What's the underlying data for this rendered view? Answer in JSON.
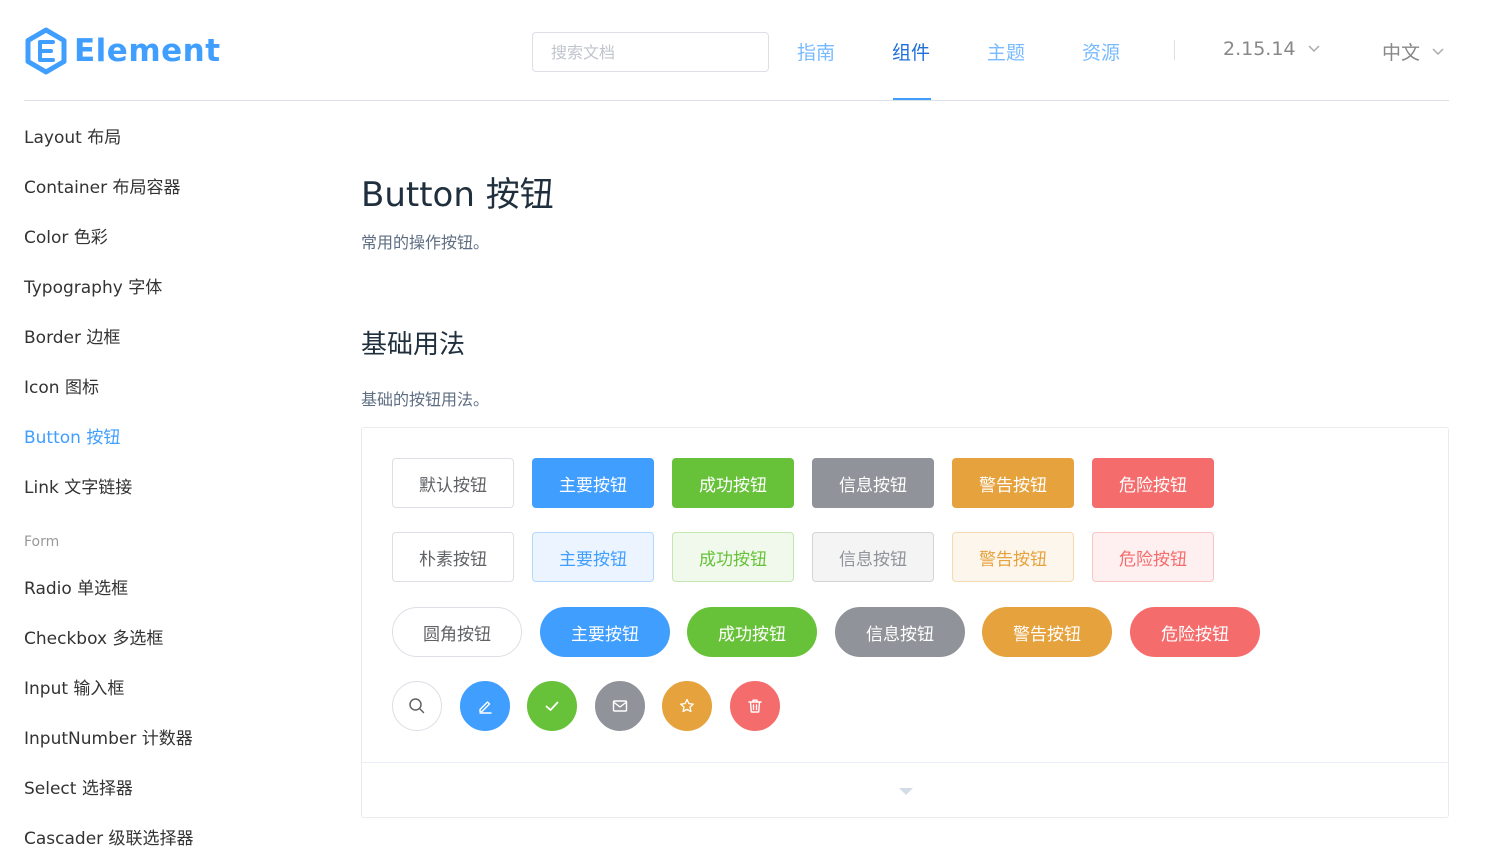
{
  "brand": {
    "name": "Element",
    "color": "#409eff"
  },
  "header": {
    "search_placeholder": "搜索文档",
    "nav": [
      "指南",
      "组件",
      "主题",
      "资源"
    ],
    "active_nav": "组件",
    "version": "2.15.14",
    "language": "中文"
  },
  "sidebar": {
    "items": [
      "Layout 布局",
      "Container 布局容器",
      "Color 色彩",
      "Typography 字体",
      "Border 边框",
      "Icon 图标",
      "Button 按钮",
      "Link 文字链接"
    ],
    "active": "Button 按钮",
    "group_form": "Form",
    "form_items": [
      "Radio 单选框",
      "Checkbox 多选框",
      "Input 输入框",
      "InputNumber 计数器",
      "Select 选择器",
      "Cascader 级联选择器"
    ]
  },
  "main": {
    "title": "Button 按钮",
    "desc": "常用的操作按钮。",
    "section_title": "基础用法",
    "section_desc": "基础的按钮用法。",
    "row1": [
      "默认按钮",
      "主要按钮",
      "成功按钮",
      "信息按钮",
      "警告按钮",
      "危险按钮"
    ],
    "row2": [
      "朴素按钮",
      "主要按钮",
      "成功按钮",
      "信息按钮",
      "警告按钮",
      "危险按钮"
    ],
    "row3": [
      "圆角按钮",
      "主要按钮",
      "成功按钮",
      "信息按钮",
      "警告按钮",
      "危险按钮"
    ],
    "row4_icons": [
      "search-icon",
      "edit-icon",
      "check-icon",
      "message-icon",
      "star-icon",
      "delete-icon"
    ]
  },
  "colors": {
    "primary": "#409eff",
    "success": "#67c23a",
    "info": "#909399",
    "warning": "#e6a23c",
    "danger": "#f56c6c"
  }
}
